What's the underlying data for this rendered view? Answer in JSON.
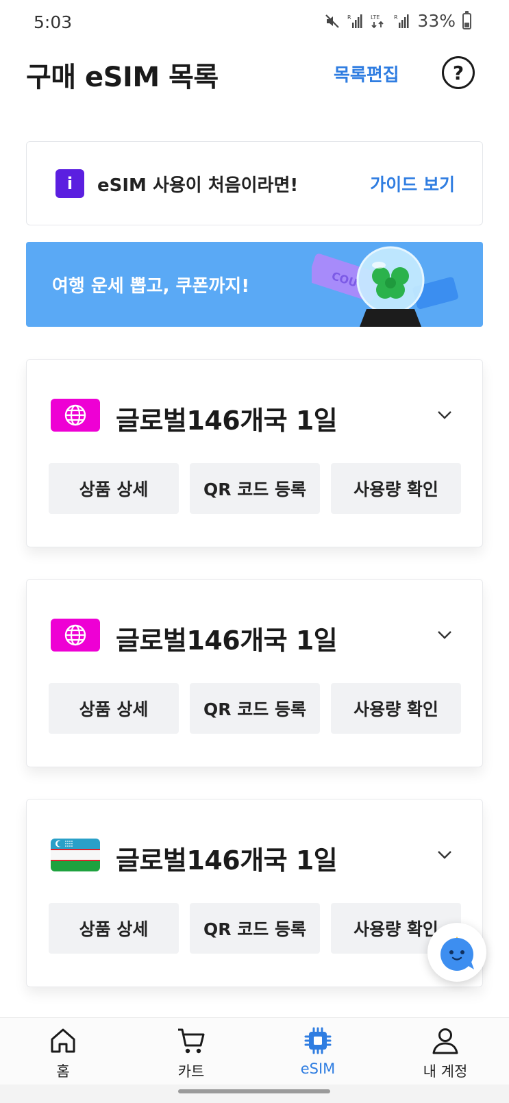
{
  "status_bar": {
    "time": "5:03",
    "battery": "33%",
    "battery_level": 0.33
  },
  "header": {
    "title": "구매 eSIM 목록",
    "edit_label": "목록편집",
    "help_label": "?"
  },
  "guide": {
    "icon_letter": "i",
    "text": "eSIM 사용이 처음이라면!",
    "link": "가이드 보기"
  },
  "banner": {
    "text": "여행 운세 뽑고, 쿠폰까지!",
    "ticket_text": "COU"
  },
  "esims": [
    {
      "title": "글로벌146개국 1일",
      "flag": "globe-icon",
      "actions": [
        "상품 상세",
        "QR 코드 등록",
        "사용량 확인"
      ]
    },
    {
      "title": "글로벌146개국 1일",
      "flag": "globe-icon",
      "actions": [
        "상품 상세",
        "QR 코드 등록",
        "사용량 확인"
      ]
    },
    {
      "title": "글로벌146개국 1일",
      "flag": "uzbekistan-flag",
      "actions": [
        "상품 상세",
        "QR 코드 등록",
        "사용량 확인"
      ]
    }
  ],
  "bottom_nav": [
    {
      "label": "홈",
      "icon": "home-icon",
      "active": false
    },
    {
      "label": "카트",
      "icon": "cart-icon",
      "active": false
    },
    {
      "label": "eSIM",
      "icon": "chip-icon",
      "active": true
    },
    {
      "label": "내 계정",
      "icon": "person-icon",
      "active": false
    }
  ],
  "colors": {
    "accent": "#2f7de1",
    "guide_icon": "#5b1fe0",
    "banner": "#5aa9f5",
    "globe_flag": "#ee00d4"
  }
}
